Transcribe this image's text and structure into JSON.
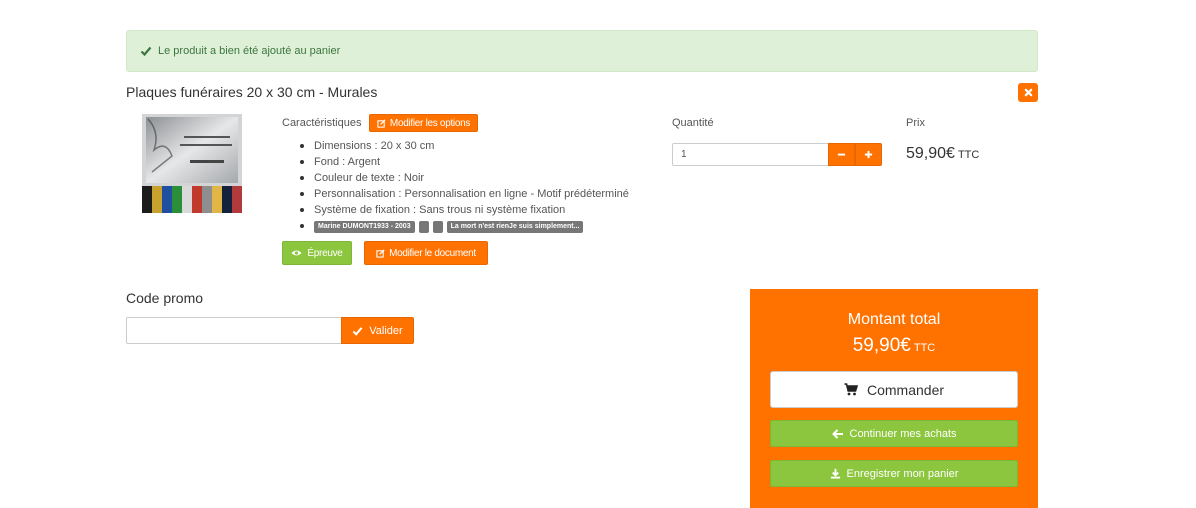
{
  "alert": {
    "message": "Le produit a bien été ajouté au panier",
    "color": "#3c763d"
  },
  "product": {
    "title": "Plaques funéraires 20 x 30 cm - Murales",
    "characteristics_label": "Caractéristiques",
    "modify_options_label": "Modifier les options",
    "features": [
      "Dimensions : 20 x 30 cm",
      "Fond : Argent",
      "Couleur de texte : Noir",
      "Personnalisation : Personnalisation en ligne - Motif prédéterminé",
      "Système de fixation : Sans trous ni système fixation"
    ],
    "tags": [
      "Marine DUMONT1933 - 2003",
      "",
      "",
      "La mort n'est rienJe suis simplement..."
    ],
    "proof_label": "Épreuve",
    "modify_document_label": "Modifier le document"
  },
  "quantity": {
    "label": "Quantité",
    "value": "1"
  },
  "price": {
    "label": "Prix",
    "value": "59,90€",
    "suffix": "TTC"
  },
  "promo": {
    "label": "Code promo",
    "value": "",
    "button_label": "Valider"
  },
  "total": {
    "title": "Montant total",
    "value": "59,90€",
    "suffix": "TTC",
    "order_label": "Commander",
    "continue_label": "Continuer mes achats",
    "save_label": "Enregistrer mon panier"
  },
  "colors": {
    "accent": "#ff7200",
    "green": "#8cc63e",
    "alert_bg": "#dff0d8"
  }
}
